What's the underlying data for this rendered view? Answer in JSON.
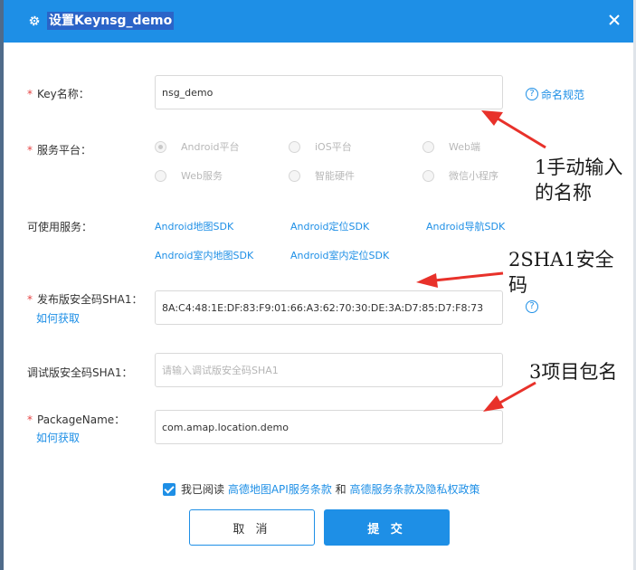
{
  "dialog": {
    "title": "设置Keynsg_demo",
    "gear_icon": "gear-icon",
    "close_icon": "close-icon"
  },
  "form": {
    "key_name": {
      "label": "Key名称：",
      "value": "nsg_demo",
      "help_link": "命名规范"
    },
    "platform": {
      "label": "服务平台：",
      "options": [
        "Android平台",
        "iOS平台",
        "Web端",
        "Web服务",
        "智能硬件",
        "微信小程序"
      ],
      "selected": "Android平台"
    },
    "services": {
      "label": "可使用服务：",
      "items": [
        "Android地图SDK",
        "Android定位SDK",
        "Android导航SDK",
        "Android室内地图SDK",
        "Android室内定位SDK"
      ]
    },
    "release_sha1": {
      "label": "发布版安全码SHA1：",
      "how_link": "如何获取",
      "value": "8A:C4:48:1E:DF:83:F9:01:66:A3:62:70:30:DE:3A:D7:85:D7:F8:73"
    },
    "debug_sha1": {
      "label": "调试版安全码SHA1：",
      "placeholder": "请输入调试版安全码SHA1"
    },
    "package_name": {
      "label": "PackageName：",
      "how_link": "如何获取",
      "value": "com.amap.location.demo"
    }
  },
  "agreement": {
    "prefix": "我已阅读",
    "link1": "高德地图API服务条款",
    "conj": "和",
    "link2": "高德服务条款及隐私权政策",
    "checked": true
  },
  "buttons": {
    "cancel": "取 消",
    "submit": "提 交"
  },
  "annotations": {
    "a1_line1": "1手动输入",
    "a1_line2": "的名称",
    "a2_line1": "2SHA1安全",
    "a2_line2": "码",
    "a3": "3项目包名"
  },
  "colors": {
    "header": "#1e8fe6",
    "accent": "#1e8fe6",
    "required": "#e64545",
    "arrow": "#e8312a"
  }
}
